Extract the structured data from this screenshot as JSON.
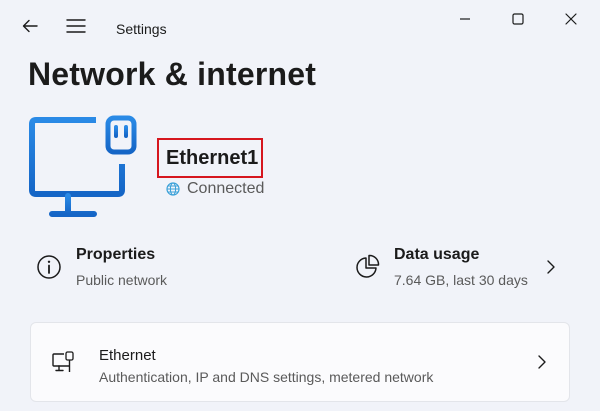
{
  "app": {
    "title": "Settings"
  },
  "page": {
    "title": "Network & internet"
  },
  "connection": {
    "name": "Ethernet1",
    "status": "Connected"
  },
  "info": {
    "properties": {
      "title": "Properties",
      "subtitle": "Public network"
    },
    "data_usage": {
      "title": "Data usage",
      "subtitle": "7.64 GB, last 30 days"
    }
  },
  "settings_card": {
    "title": "Ethernet",
    "subtitle": "Authentication, IP and DNS settings, metered network"
  },
  "icons": {
    "back": "arrow-left-icon",
    "menu": "hamburger-icon",
    "minimize": "minimize-icon",
    "maximize": "maximize-icon",
    "close": "close-icon",
    "hero": "ethernet-monitor-icon",
    "globe": "globe-icon",
    "properties": "info-icon",
    "data_usage": "pie-chart-icon",
    "chevron": "chevron-right-icon",
    "ethernet": "ethernet-port-icon"
  },
  "colors": {
    "accent": "#1a73d9",
    "highlight_border": "#d6161e",
    "globe": "#3aa0d8"
  }
}
